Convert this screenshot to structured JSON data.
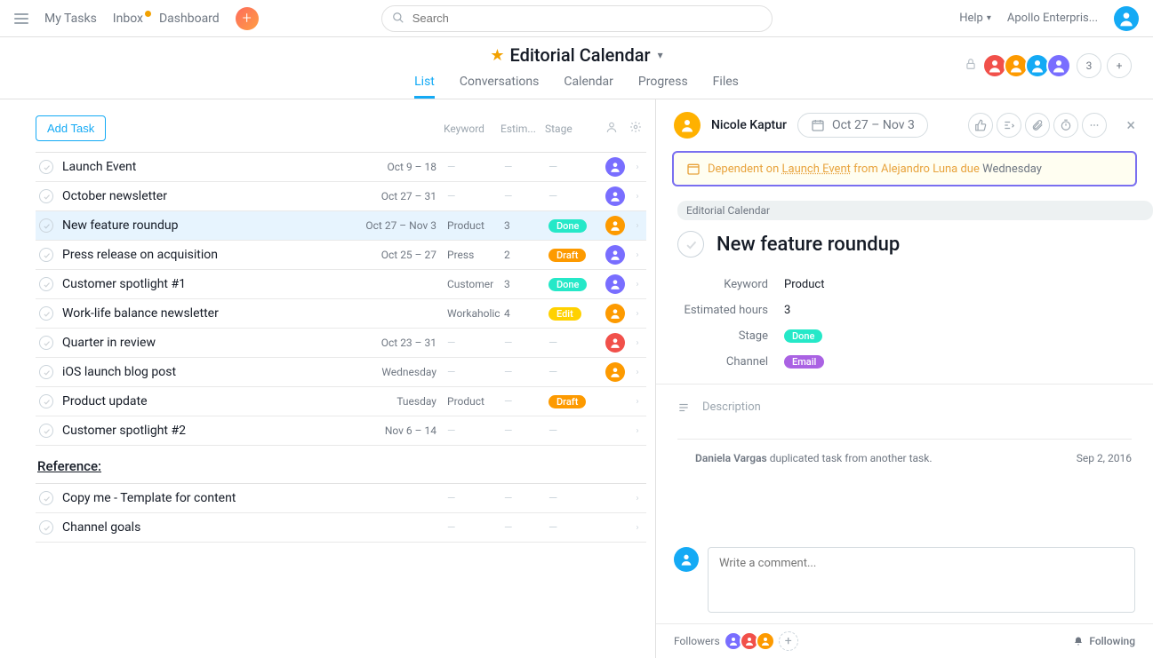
{
  "nav": {
    "links": [
      "My Tasks",
      "Inbox",
      "Dashboard"
    ],
    "search_placeholder": "Search",
    "help": "Help",
    "workspace": "Apollo Enterpris..."
  },
  "project": {
    "title": "Editorial Calendar",
    "tabs": [
      "List",
      "Conversations",
      "Calendar",
      "Progress",
      "Files"
    ],
    "members_overflow": "3",
    "member_colors": [
      "#f1504a",
      "#fd9a00",
      "#14aaf5",
      "#796eff"
    ]
  },
  "list": {
    "add_task": "Add Task",
    "cols": {
      "keyword": "Keyword",
      "estimated": "Estim...",
      "stage": "Stage"
    },
    "tasks": [
      {
        "name": "Launch Event",
        "date": "Oct 9 – 18",
        "kw": "",
        "est": "",
        "stage": "",
        "avatar": "#796eff"
      },
      {
        "name": "October newsletter",
        "date": "Oct 27 – 31",
        "kw": "",
        "est": "",
        "stage": "",
        "avatar": "#796eff"
      },
      {
        "name": "New feature roundup",
        "date": "Oct 27 – Nov 3",
        "kw": "Product",
        "est": "3",
        "stage": "Done",
        "avatar": "#fd9a00",
        "selected": true
      },
      {
        "name": "Press release on acquisition",
        "date": "Oct 25 – 27",
        "kw": "Press",
        "est": "2",
        "stage": "Draft",
        "avatar": "#796eff"
      },
      {
        "name": "Customer spotlight #1",
        "date": "",
        "kw": "Customer",
        "est": "3",
        "stage": "Done",
        "avatar": "#796eff"
      },
      {
        "name": "Work-life balance newsletter",
        "date": "",
        "kw": "Workaholic",
        "est": "4",
        "stage": "Edit",
        "avatar": "#fd9a00"
      },
      {
        "name": "Quarter in review",
        "date": "Oct 23 – 31",
        "kw": "",
        "est": "",
        "stage": "",
        "avatar": "#f1504a"
      },
      {
        "name": "iOS launch blog post",
        "date": "Wednesday",
        "kw": "",
        "est": "",
        "stage": "",
        "avatar": "#fd9a00"
      },
      {
        "name": "Product update",
        "date": "Tuesday",
        "kw": "Product",
        "est": "",
        "stage": "Draft",
        "avatar": ""
      },
      {
        "name": "Customer spotlight #2",
        "date": "Nov 6 – 14",
        "kw": "",
        "est": "",
        "stage": "",
        "avatar": ""
      }
    ],
    "section": "Reference:",
    "ref_tasks": [
      {
        "name": "Copy me - Template for content"
      },
      {
        "name": "Channel goals"
      }
    ]
  },
  "detail": {
    "assignee": "Nicole Kaptur",
    "date_range": "Oct 27 – Nov 3",
    "dependency": {
      "prefix": "Dependent on",
      "task": "Launch Event",
      "from": "from Alejandro Luna due",
      "due": "Wednesday"
    },
    "project_chip": "Editorial Calendar",
    "title": "New feature roundup",
    "fields": {
      "keyword_label": "Keyword",
      "keyword_val": "Product",
      "est_label": "Estimated hours",
      "est_val": "3",
      "stage_label": "Stage",
      "stage_val": "Done",
      "channel_label": "Channel",
      "channel_val": "Email"
    },
    "description_label": "Description",
    "activity": {
      "who": "Daniela Vargas",
      "action": "duplicated task from another task.",
      "when": "Sep 2, 2016"
    },
    "comment_placeholder": "Write a comment...",
    "followers_label": "Followers",
    "follower_colors": [
      "#796eff",
      "#f1504a",
      "#fd9a00"
    ],
    "following": "Following"
  }
}
